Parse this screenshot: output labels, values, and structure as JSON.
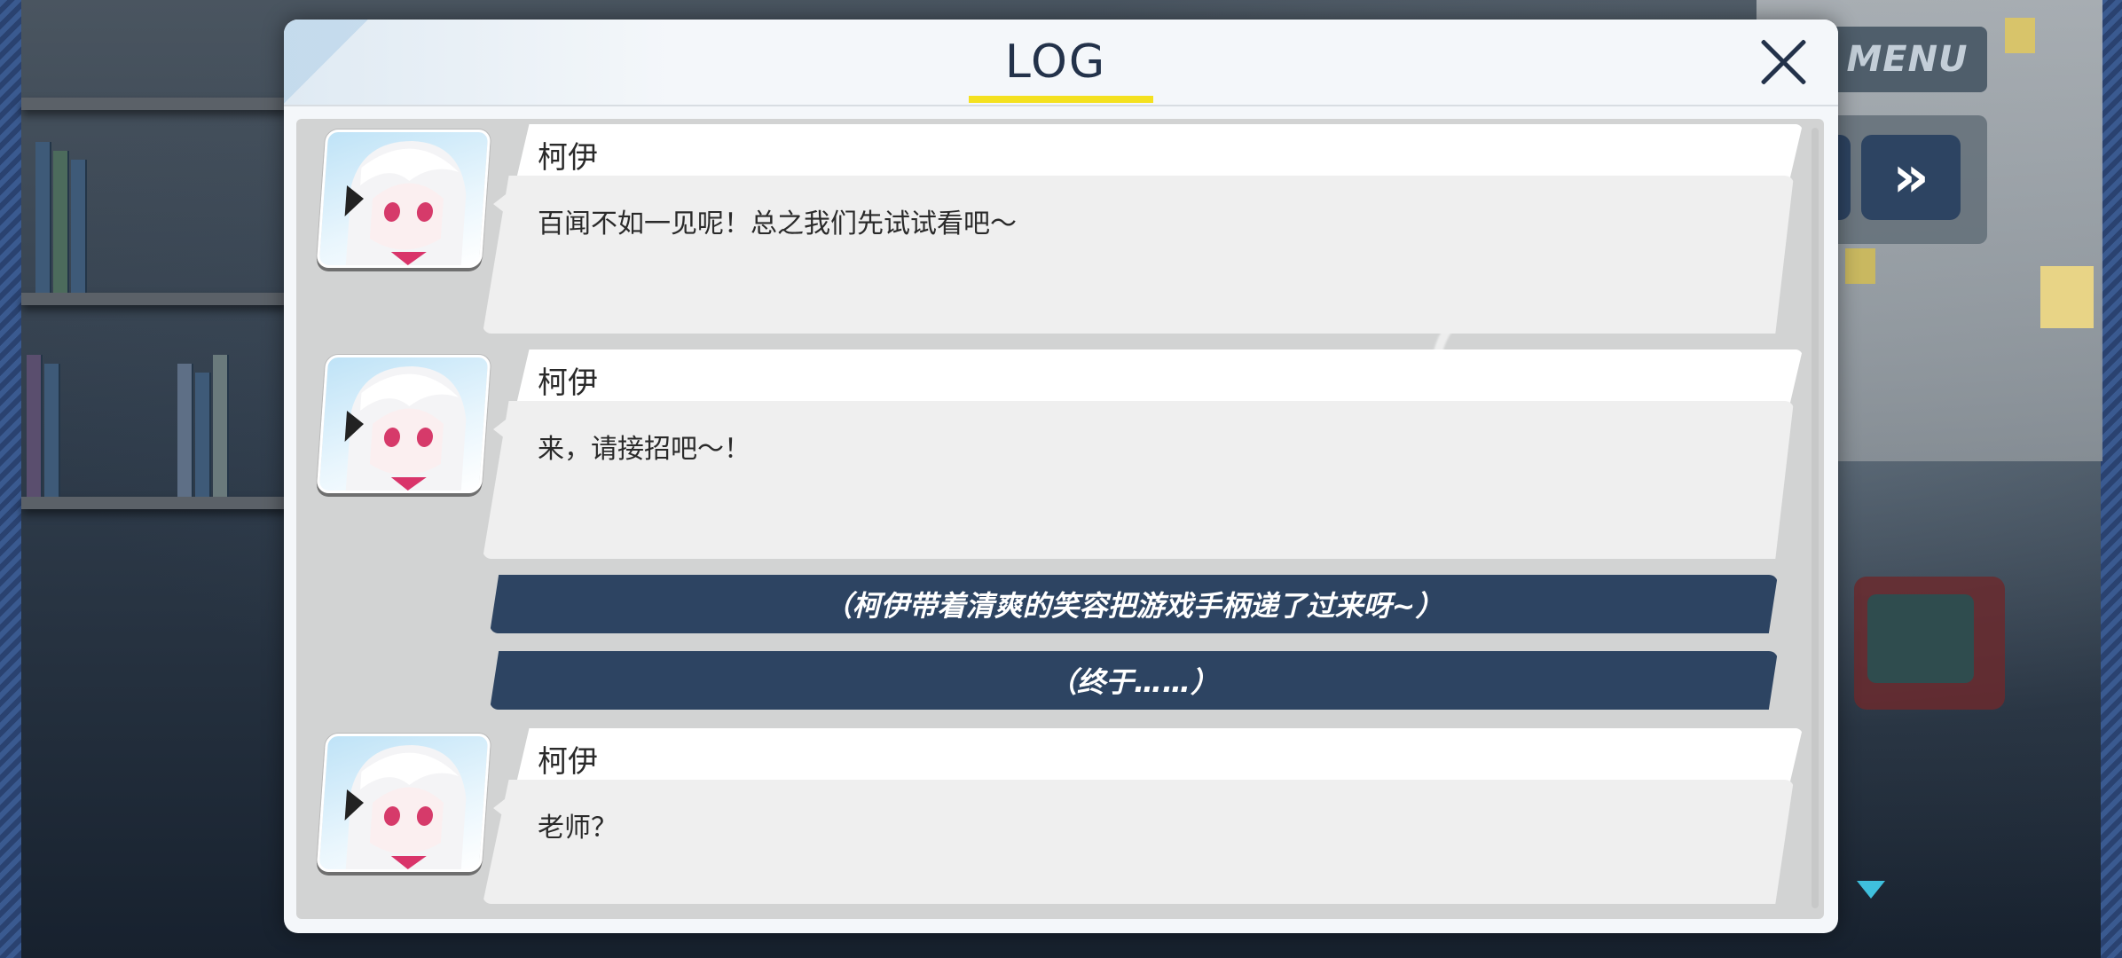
{
  "background": {
    "menu_label": "MENU",
    "fast_forward_icon": "double-chevron-right-icon"
  },
  "log": {
    "title": "LOG",
    "close_icon": "close-x-icon",
    "entries": [
      {
        "type": "dialogue",
        "speaker": "柯伊",
        "text": "百闻不如一见呢！总之我们先试试看吧〜"
      },
      {
        "type": "dialogue",
        "speaker": "柯伊",
        "text": "来，请接招吧〜！"
      },
      {
        "type": "narration",
        "text": "（柯伊带着清爽的笑容把游戏手柄递了过来呀~）"
      },
      {
        "type": "narration",
        "text": "（终于……）"
      },
      {
        "type": "dialogue",
        "speaker": "柯伊",
        "text": "老师？"
      }
    ]
  },
  "colors": {
    "title_underline": "#f4e11f",
    "narration_bg": "#2d4462",
    "title_text": "#23324a"
  }
}
